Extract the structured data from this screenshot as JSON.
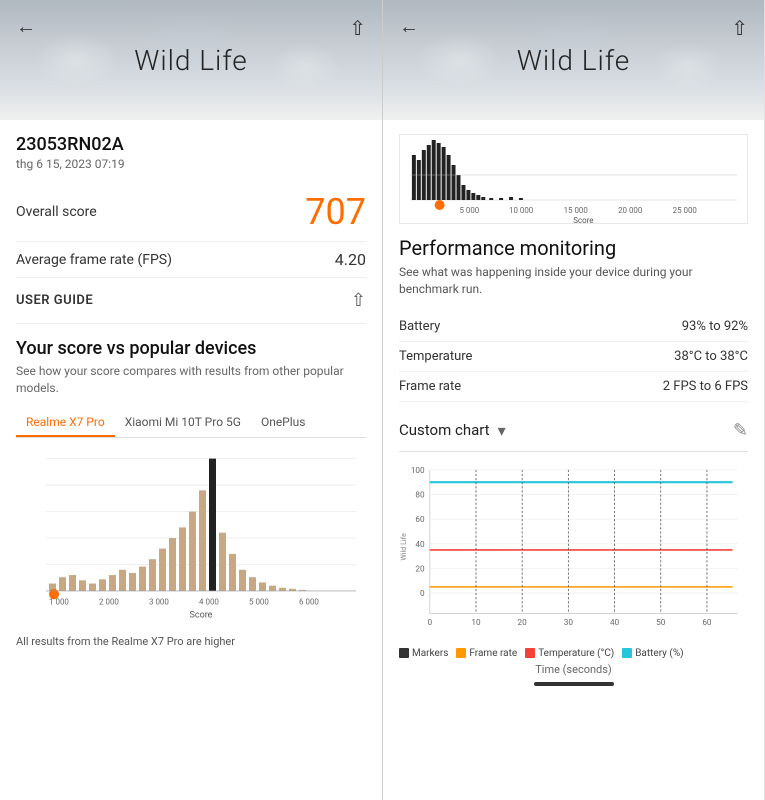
{
  "panel1": {
    "hero_title": "Wild Life",
    "back_btn": "←",
    "share_btn": "⇧",
    "device_id": "23053RN02A",
    "device_date": "thg 6 15, 2023 07:19",
    "overall_score_label": "Overall score",
    "overall_score_value": "707",
    "avg_fps_label": "Average frame rate (FPS)",
    "avg_fps_value": "4.20",
    "user_guide_label": "USER GUIDE",
    "section_title": "Your score vs popular devices",
    "section_desc": "See how your score compares with results from other popular models.",
    "tabs": [
      {
        "label": "Realme X7 Pro",
        "active": true
      },
      {
        "label": "Xiaomi Mi 10T Pro 5G",
        "active": false
      },
      {
        "label": "OnePlus",
        "active": false
      }
    ],
    "chart_dot_label": "●",
    "score_axis_label": "Score",
    "score_axis_values": [
      "1 000",
      "2 000",
      "3 000",
      "4 000",
      "5 000",
      "6 000"
    ],
    "chart_footer": "All results from the Realme X7 Pro are higher"
  },
  "panel2": {
    "hero_title": "Wild Life",
    "back_btn": "←",
    "share_btn": "⇧",
    "perf_title": "Performance monitoring",
    "perf_desc": "See what was happening inside your device during your benchmark run.",
    "perf_rows": [
      {
        "key": "Battery",
        "val": "93% to 92%"
      },
      {
        "key": "Temperature",
        "val": "38°C to 38°C"
      },
      {
        "key": "Frame rate",
        "val": "2 FPS to 6 FPS"
      }
    ],
    "custom_chart_label": "Custom chart",
    "dropdown_icon": "▾",
    "edit_icon": "✎",
    "chart_y_values": [
      "100",
      "80",
      "60",
      "40",
      "20",
      "0"
    ],
    "chart_x_values": [
      "0",
      "10",
      "20",
      "30",
      "40",
      "50",
      "60"
    ],
    "y_axis_label": "Wild Life",
    "time_label": "Time (seconds)",
    "legend": [
      {
        "label": "Markers",
        "color": "#333"
      },
      {
        "label": "Frame rate",
        "color": "#FF9800"
      },
      {
        "label": "Temperature (°C)",
        "color": "#f44336"
      },
      {
        "label": "Battery (%)",
        "color": "#26C6DA"
      }
    ]
  }
}
